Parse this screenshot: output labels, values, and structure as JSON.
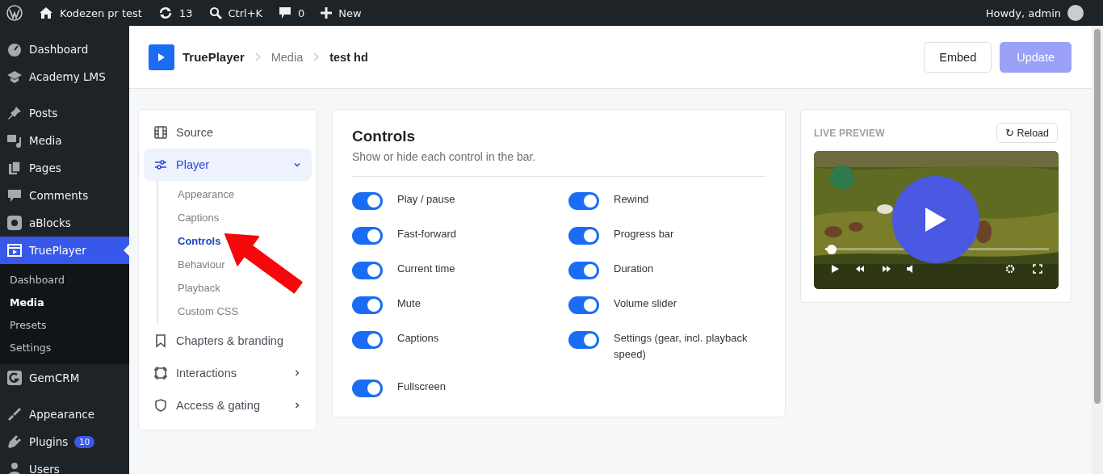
{
  "admin_bar": {
    "site": "Kodezen pr test",
    "updates": "13",
    "search": "Ctrl+K",
    "comments": "0",
    "new": "New",
    "greeting": "Howdy, admin"
  },
  "sidebar": {
    "items": [
      {
        "label": "Dashboard",
        "selected": false
      },
      {
        "label": "Academy LMS",
        "selected": false
      },
      {
        "label": "Posts",
        "selected": false
      },
      {
        "label": "Media",
        "selected": false
      },
      {
        "label": "Pages",
        "selected": false
      },
      {
        "label": "Comments",
        "selected": false
      },
      {
        "label": "aBlocks",
        "selected": false
      },
      {
        "label": "TruePlayer",
        "selected": true,
        "children": [
          {
            "label": "Dashboard",
            "selected": false
          },
          {
            "label": "Media",
            "selected": true
          },
          {
            "label": "Presets",
            "selected": false
          },
          {
            "label": "Settings",
            "selected": false
          }
        ]
      },
      {
        "label": "GemCRM",
        "selected": false
      },
      {
        "label": "Appearance",
        "selected": false
      },
      {
        "label": "Plugins",
        "selected": false,
        "badge": "10"
      },
      {
        "label": "Users",
        "selected": false
      }
    ]
  },
  "header": {
    "brand": "TruePlayer",
    "breadcrumb": [
      "Media",
      "test hd"
    ],
    "buttons": [
      {
        "label": "Embed",
        "kind": "secondary",
        "disabled": false
      },
      {
        "label": "Update",
        "kind": "primary",
        "disabled": true
      }
    ]
  },
  "nav": [
    {
      "label": "Source",
      "kind": "link",
      "selected": false
    },
    {
      "label": "Player",
      "kind": "group",
      "expanded": true,
      "selected": true,
      "children": [
        {
          "label": "Appearance",
          "selected": false
        },
        {
          "label": "Captions",
          "selected": false
        },
        {
          "label": "Controls",
          "selected": true
        },
        {
          "label": "Behaviour",
          "selected": false
        },
        {
          "label": "Playback",
          "selected": false
        },
        {
          "label": "Custom CSS",
          "selected": false
        }
      ]
    },
    {
      "label": "Chapters & branding",
      "kind": "link",
      "selected": false
    },
    {
      "label": "Interactions",
      "kind": "group",
      "expanded": false,
      "selected": false
    },
    {
      "label": "Access & gating",
      "kind": "group",
      "expanded": false,
      "selected": false
    }
  ],
  "controls": {
    "title": "Controls",
    "subtitle": "Show or hide each control in the bar.",
    "toggles": [
      {
        "label": "Play / pause",
        "on": true
      },
      {
        "label": "Rewind",
        "on": true
      },
      {
        "label": "Fast-forward",
        "on": true
      },
      {
        "label": "Progress bar",
        "on": true
      },
      {
        "label": "Current time",
        "on": true
      },
      {
        "label": "Duration",
        "on": true
      },
      {
        "label": "Mute",
        "on": true
      },
      {
        "label": "Volume slider",
        "on": true
      },
      {
        "label": "Captions",
        "on": true
      },
      {
        "label": "Settings (gear, incl. playback speed)",
        "on": true
      },
      {
        "label": "Fullscreen",
        "on": true
      }
    ]
  },
  "preview": {
    "title": "LIVE PREVIEW",
    "reload": "↻ Reload",
    "video": {
      "kind": "picture",
      "level": 0.03
    }
  }
}
